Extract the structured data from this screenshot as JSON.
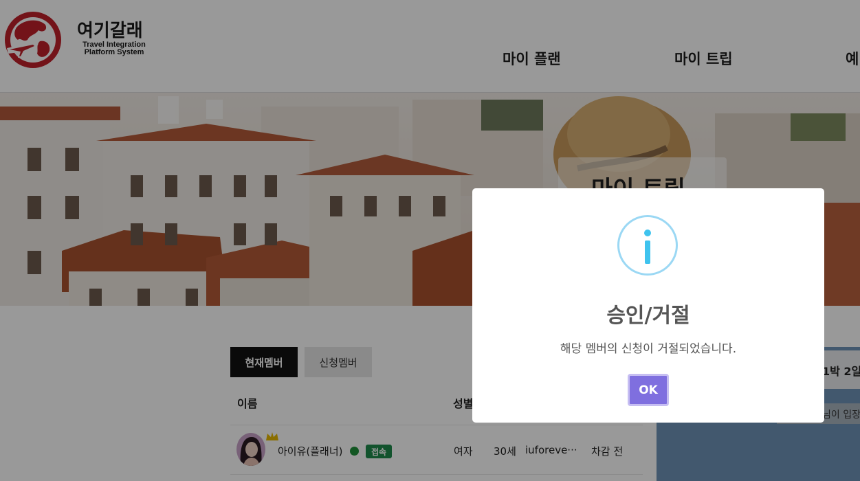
{
  "brand": {
    "name": "여기갈래",
    "subtitle_line1": "Travel Integration",
    "subtitle_line2": "Platform System",
    "logo_icon": "globe-airplane-icon"
  },
  "nav": {
    "items": [
      {
        "label": "마이 플랜"
      },
      {
        "label": "마이 트립"
      },
      {
        "label": "예"
      }
    ]
  },
  "hero": {
    "title": "마이 트립"
  },
  "tabs": [
    {
      "label": "현재멤버",
      "active": true
    },
    {
      "label": "신청멤버",
      "active": false
    }
  ],
  "table": {
    "headers": [
      "이름",
      "성별"
    ],
    "rows": [
      {
        "name": "아이유(플래너)",
        "status_badge": "접속",
        "gender": "여자",
        "age": "30세",
        "email": "iuforeve···",
        "extra": "차감 전"
      }
    ]
  },
  "side_panel": {
    "header": "1박 2일",
    "chip": "님이 입장"
  },
  "modal": {
    "icon": "info-icon",
    "title": "승인/거절",
    "message": "해당 멤버의 신청이 거절되었습니다.",
    "ok_label": "OK"
  },
  "colors": {
    "brand_red": "#c0202a",
    "ok_button": "#7f6fdf",
    "info_icon": "#3fc3ee",
    "online_green": "#1e8f3a",
    "badge_green": "#1f8a4c"
  }
}
